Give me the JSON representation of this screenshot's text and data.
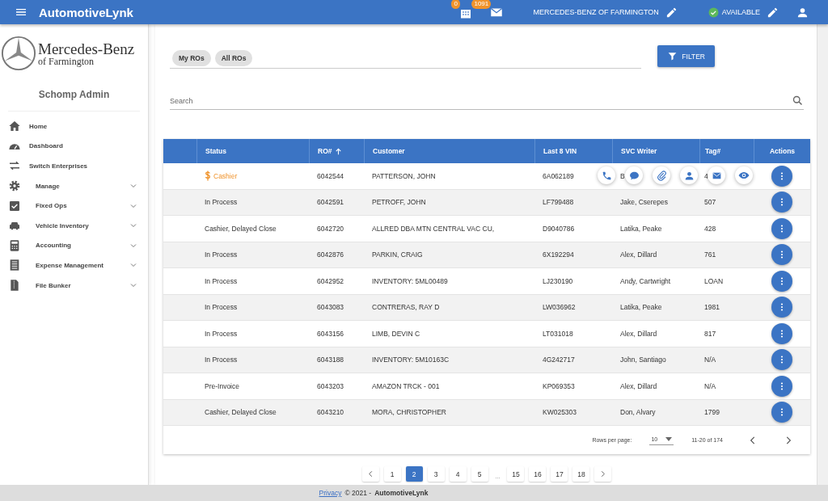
{
  "app_bar": {
    "title": "AutomotiveLynk",
    "tasks_badge": "0",
    "mail_badge": "1091",
    "dealer": "MERCEDES-BENZ OF FARMINGTON",
    "status": "AVAILABLE"
  },
  "sidebar": {
    "logo_name": "Mercedes-Benz",
    "logo_sub": "of Farmington",
    "user": "Schomp Admin",
    "items": [
      {
        "label": "Home",
        "expandable": false
      },
      {
        "label": "Dashboard",
        "expandable": false
      },
      {
        "label": "Switch Enterprises",
        "expandable": false
      },
      {
        "label": "Manage",
        "expandable": true
      },
      {
        "label": "Fixed Ops",
        "expandable": true
      },
      {
        "label": "Vehicle Inventory",
        "expandable": true
      },
      {
        "label": "Accounting",
        "expandable": true
      },
      {
        "label": "Expense Management",
        "expandable": true
      },
      {
        "label": "File Bunker",
        "expandable": true
      }
    ]
  },
  "chips": [
    {
      "label": "My ROs"
    },
    {
      "label": "All ROs"
    }
  ],
  "filter_button": "FILTER",
  "search": {
    "placeholder": "Search"
  },
  "table": {
    "columns": [
      "Status",
      "RO#",
      "Customer",
      "Last 8 VIN",
      "SVC Writer",
      "Tag#",
      "Actions"
    ],
    "rows": [
      {
        "status": "Cashier",
        "flagged": true,
        "hovered": true,
        "ro": "6042544",
        "customer": "PATTERSON, JOHN",
        "vin": "6A062189",
        "writer": "B",
        "tag": "4"
      },
      {
        "status": "In Process",
        "flagged": false,
        "hovered": false,
        "ro": "6042591",
        "customer": "PETROFF, JOHN",
        "vin": "LF799488",
        "writer": "Jake, Cserepes",
        "tag": "507"
      },
      {
        "status": "Cashier, Delayed Close",
        "flagged": false,
        "hovered": false,
        "ro": "6042720",
        "customer": "ALLRED DBA MTN CENTRAL VAC CU,",
        "vin": "D9040786",
        "writer": "Latika, Peake",
        "tag": "428"
      },
      {
        "status": "In Process",
        "flagged": false,
        "hovered": false,
        "ro": "6042876",
        "customer": "PARKIN, CRAIG",
        "vin": "6X192294",
        "writer": "Alex, Dillard",
        "tag": "761"
      },
      {
        "status": "In Process",
        "flagged": false,
        "hovered": false,
        "ro": "6042952",
        "customer": "INVENTORY: 5ML00489",
        "vin": "LJ230190",
        "writer": "Andy, Cartwright",
        "tag": "LOAN"
      },
      {
        "status": "In Process",
        "flagged": false,
        "hovered": false,
        "ro": "6043083",
        "customer": "CONTRERAS, RAY D",
        "vin": "LW036962",
        "writer": "Latika, Peake",
        "tag": "1981"
      },
      {
        "status": "In Process",
        "flagged": false,
        "hovered": false,
        "ro": "6043156",
        "customer": "LIMB, DEVIN C",
        "vin": "LT031018",
        "writer": "Alex, Dillard",
        "tag": "817"
      },
      {
        "status": "In Process",
        "flagged": false,
        "hovered": false,
        "ro": "6043188",
        "customer": "INVENTORY: 5M10163C",
        "vin": "4G242717",
        "writer": "John, Santiago",
        "tag": "N/A"
      },
      {
        "status": "Pre-Invoice",
        "flagged": false,
        "hovered": false,
        "ro": "6043203",
        "customer": "AMAZON TRCK - 001",
        "vin": "KP069353",
        "writer": "Alex, Dillard",
        "tag": "N/A"
      },
      {
        "status": "Cashier, Delayed Close",
        "flagged": false,
        "hovered": false,
        "ro": "6043210",
        "customer": "MORA, CHRISTOPHER",
        "vin": "KW025303",
        "writer": "Don, Alvary",
        "tag": "1799"
      }
    ],
    "rows_per_page_label": "Rows per page:",
    "rows_per_page": "10",
    "range": "11-20 of 174"
  },
  "pagination": [
    {
      "label": "1",
      "kind": "page",
      "selected": false
    },
    {
      "label": "2",
      "kind": "page",
      "selected": true
    },
    {
      "label": "3",
      "kind": "page",
      "selected": false
    },
    {
      "label": "4",
      "kind": "page",
      "selected": false
    },
    {
      "label": "5",
      "kind": "page",
      "selected": false
    },
    {
      "label": "...",
      "kind": "ellipsis"
    },
    {
      "label": "15",
      "kind": "page",
      "selected": false
    },
    {
      "label": "16",
      "kind": "page",
      "selected": false
    },
    {
      "label": "17",
      "kind": "page",
      "selected": false
    },
    {
      "label": "18",
      "kind": "page",
      "selected": false
    }
  ],
  "footer": {
    "link": "Privacy",
    "copyright": "© 2021 -",
    "brand": "AutomotiveLynk"
  }
}
